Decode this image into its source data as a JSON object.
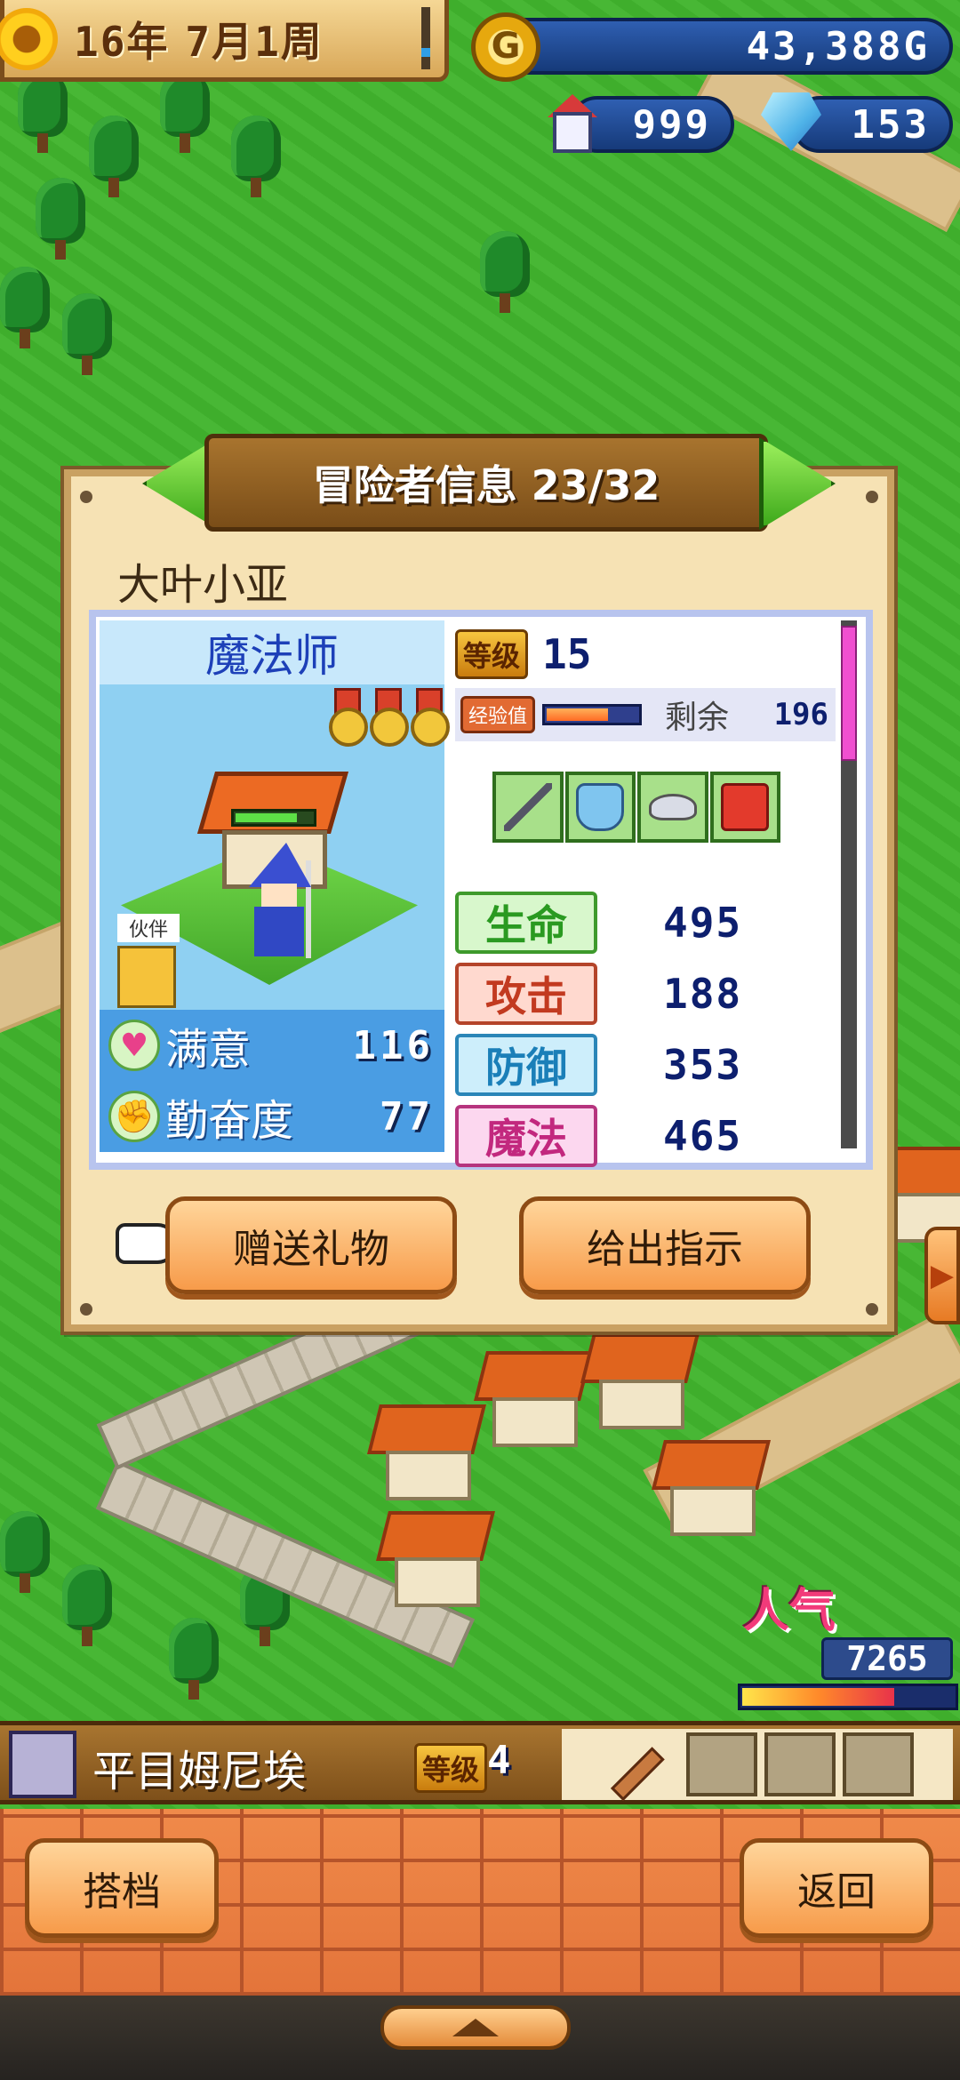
{
  "hud": {
    "year": "16年",
    "month_week": "7月1周",
    "gold": "43,388G",
    "gold_icon": "G",
    "castle_count": "999",
    "crystal_count": "153"
  },
  "modal": {
    "title": "冒险者信息 23/32",
    "adventurer_name": "大叶小亚",
    "class_name": "魔法师",
    "partner_label": "伙伴",
    "level_label": "等级",
    "level": "15",
    "exp_label": "经验值",
    "exp_fill": 0.68,
    "remaining_label": "剩余",
    "remaining_exp": "196",
    "hp_fill": 0.8,
    "equipment": [
      "staff-icon",
      "armor-icon",
      "hat-icon",
      "bag-icon"
    ],
    "traits": [
      {
        "label": "满意",
        "value": "116",
        "icon": "heart-icon"
      },
      {
        "label": "勤奋度",
        "value": "77",
        "icon": "fist-icon"
      }
    ],
    "stats": [
      {
        "label": "生命",
        "value": "495"
      },
      {
        "label": "攻击",
        "value": "188"
      },
      {
        "label": "防御",
        "value": "353"
      },
      {
        "label": "魔法",
        "value": "465"
      }
    ],
    "gift_button": "赠送礼物",
    "instruct_button": "给出指示"
  },
  "popularity": {
    "label": "人气",
    "value": "7265",
    "fill": 0.72
  },
  "party": {
    "member_name": "平目姆尼埃",
    "level_label": "等级",
    "level": "4"
  },
  "footer": {
    "partner_button": "搭档",
    "back_button": "返回"
  },
  "colors": {
    "accent_green": "#3ea91b",
    "panel_border": "#b8c4ee",
    "button_orange": "#f79b4a"
  }
}
